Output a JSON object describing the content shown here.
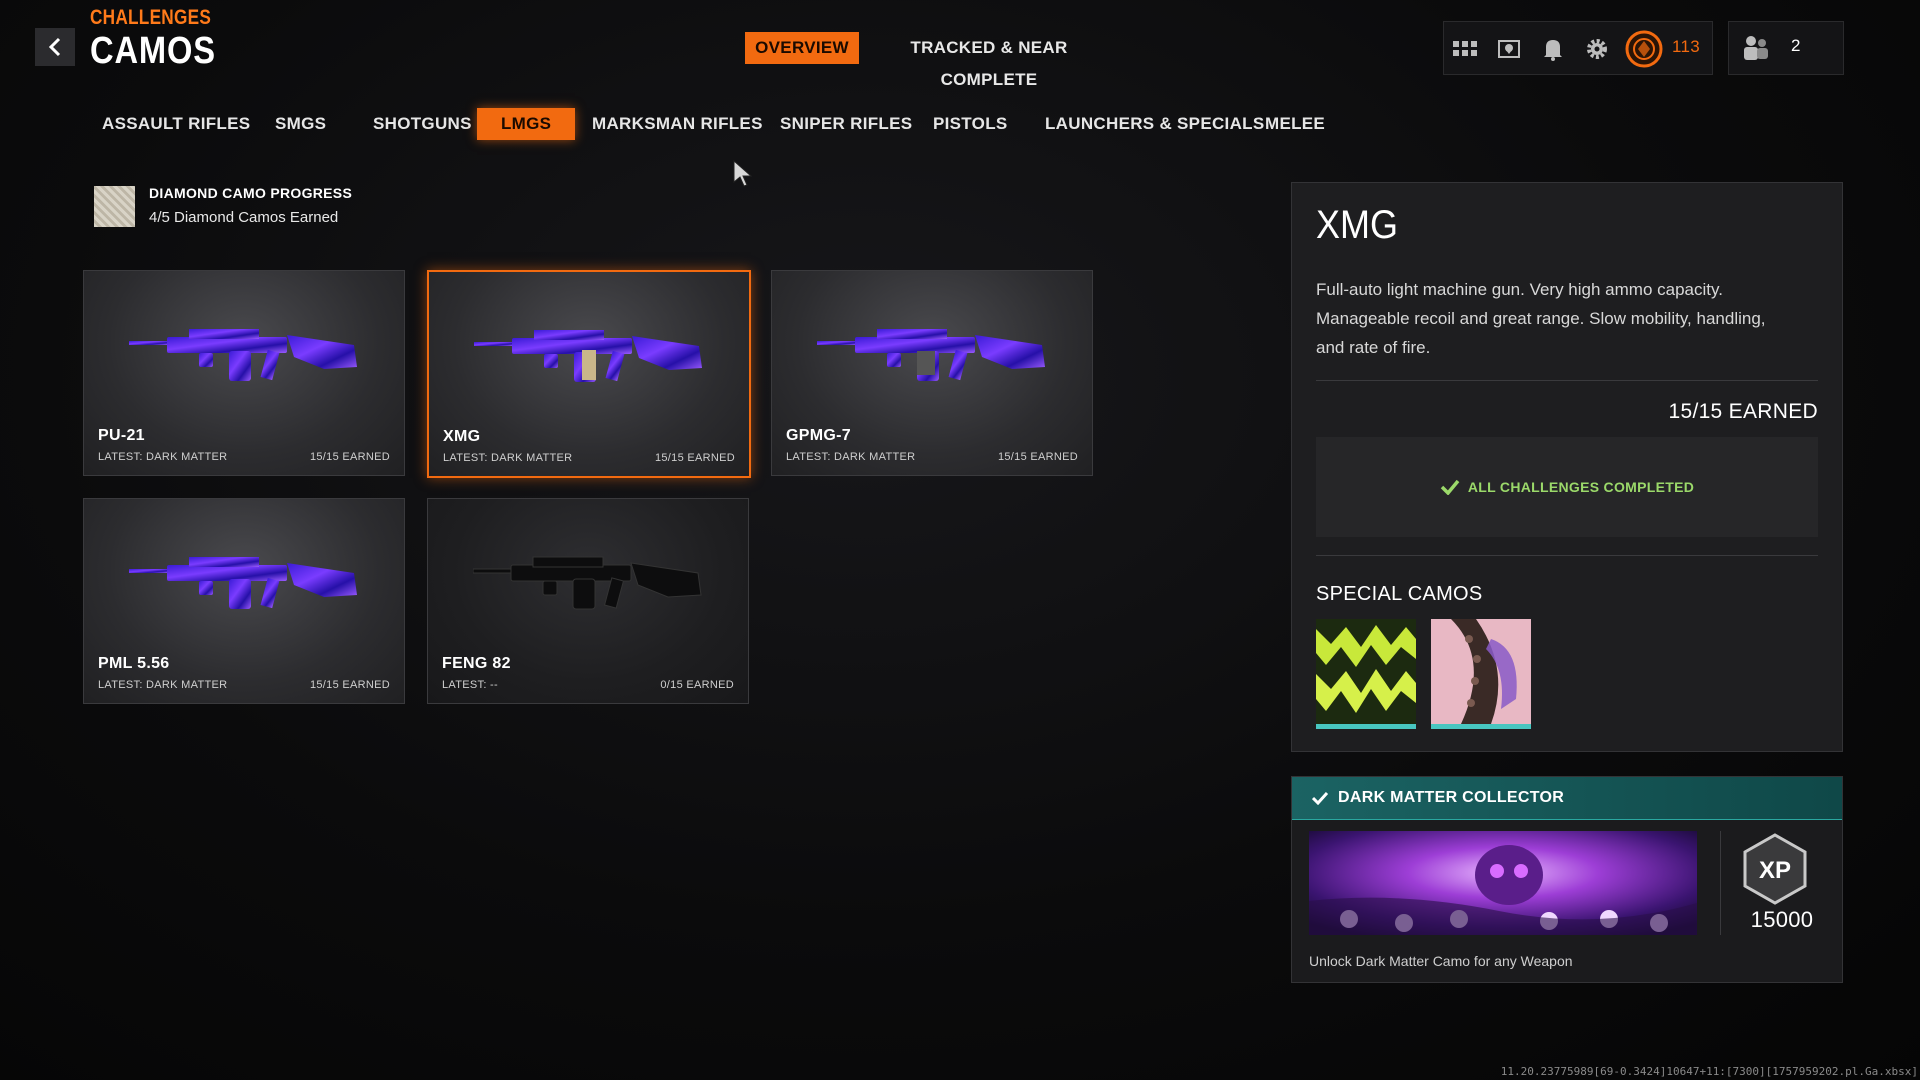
{
  "header": {
    "breadcrumb": "CHALLENGES",
    "title": "CAMOS",
    "tabs": [
      {
        "label": "OVERVIEW",
        "active": true
      },
      {
        "label": "TRACKED & NEAR COMPLETE",
        "active": false
      }
    ],
    "icons": [
      "grid-icon",
      "map-icon",
      "bell-icon",
      "gear-icon",
      "prestige-emblem-icon"
    ],
    "level": "113",
    "friends_count": "2",
    "accent_color": "#f26a10"
  },
  "categories": [
    {
      "label": "ASSAULT RIFLES",
      "active": false
    },
    {
      "label": "SMGS",
      "active": false
    },
    {
      "label": "SHOTGUNS",
      "active": false
    },
    {
      "label": "LMGS",
      "active": true
    },
    {
      "label": "MARKSMAN RIFLES",
      "active": false
    },
    {
      "label": "SNIPER RIFLES",
      "active": false
    },
    {
      "label": "PISTOLS",
      "active": false
    },
    {
      "label": "LAUNCHERS & SPECIALS",
      "active": false
    },
    {
      "label": "MELEE",
      "active": false
    }
  ],
  "progress": {
    "title": "DIAMOND CAMO PROGRESS",
    "subtitle": "4/5 Diamond Camos Earned"
  },
  "weapons": [
    {
      "name": "PU-21",
      "latest": "LATEST: DARK MATTER",
      "earned": "15/15 EARNED",
      "selected": false,
      "camo": "dark-matter"
    },
    {
      "name": "XMG",
      "latest": "LATEST: DARK MATTER",
      "earned": "15/15 EARNED",
      "selected": true,
      "camo": "dark-matter"
    },
    {
      "name": "GPMG-7",
      "latest": "LATEST: DARK MATTER",
      "earned": "15/15 EARNED",
      "selected": false,
      "camo": "dark-matter"
    },
    {
      "name": "PML 5.56",
      "latest": "LATEST: DARK MATTER",
      "earned": "15/15 EARNED",
      "selected": false,
      "camo": "dark-matter"
    },
    {
      "name": "FENG 82",
      "latest": "LATEST: --",
      "earned": "0/15 EARNED",
      "selected": false,
      "camo": "none"
    }
  ],
  "detail": {
    "name": "XMG",
    "description": "Full-auto light machine gun.  Very high ammo capacity. Manageable recoil and great range. Slow mobility, handling, and rate of fire.",
    "earned": "15/15 EARNED",
    "status": "ALL CHALLENGES COMPLETED",
    "special_camos_title": "SPECIAL CAMOS",
    "special_camos": [
      "yellow-zigzag-camo",
      "pink-snakeskin-camo"
    ]
  },
  "challenge": {
    "title": "DARK MATTER COLLECTOR",
    "xp": "15000",
    "description": "Unlock Dark Matter Camo for any Weapon"
  },
  "footer": {
    "build_id": "11.20.23775989[69-0.3424]10647+11:[7300][1757959202.pl.Ga.xbsx]"
  }
}
